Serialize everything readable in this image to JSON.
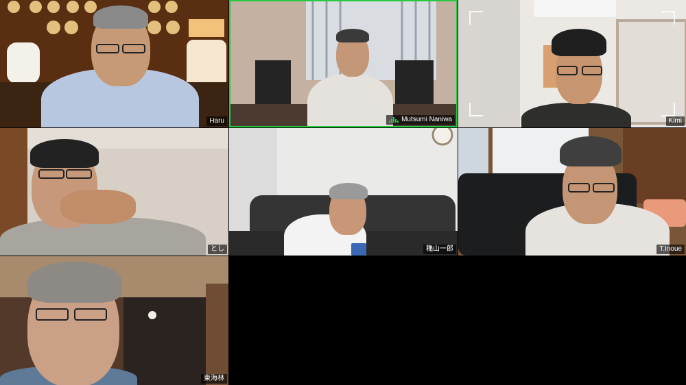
{
  "meeting": {
    "participants": [
      {
        "id": "p1",
        "name": "Haru",
        "speaking": false
      },
      {
        "id": "p2",
        "name": "Mutsumi Naniwa",
        "speaking": true
      },
      {
        "id": "p3",
        "name": "Kimi",
        "speaking": false
      },
      {
        "id": "p4",
        "name": "とし",
        "speaking": false
      },
      {
        "id": "p5",
        "name": "穐山一郎",
        "speaking": false
      },
      {
        "id": "p6",
        "name": "T.Inoue",
        "speaking": false
      },
      {
        "id": "p7",
        "name": "東海林",
        "speaking": false
      }
    ]
  },
  "colors": {
    "active_speaker_border": "#27c93f",
    "background": "#000000"
  }
}
